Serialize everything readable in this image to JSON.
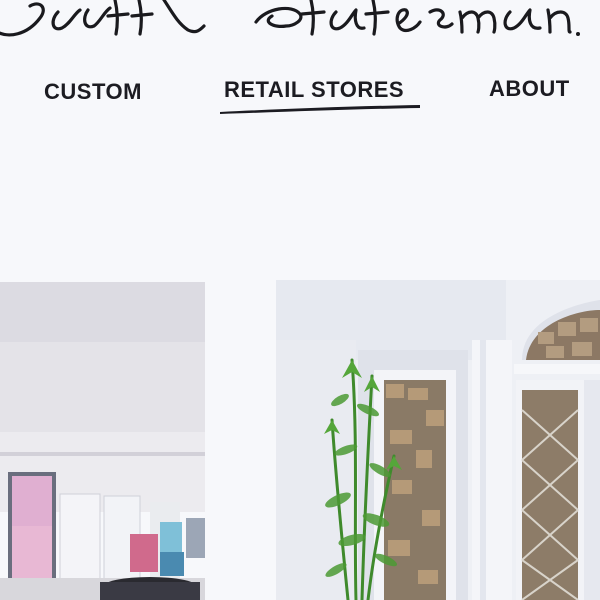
{
  "brand": {
    "logo_text": "Scott Statesman"
  },
  "nav": {
    "items": [
      {
        "label": "CUSTOM"
      },
      {
        "label": "RETAIL STORES",
        "active": true
      },
      {
        "label": "ABOUT"
      }
    ]
  },
  "colors": {
    "background": "#f7f8fb",
    "text": "#1c1c22",
    "underline": "#1c1c22"
  }
}
